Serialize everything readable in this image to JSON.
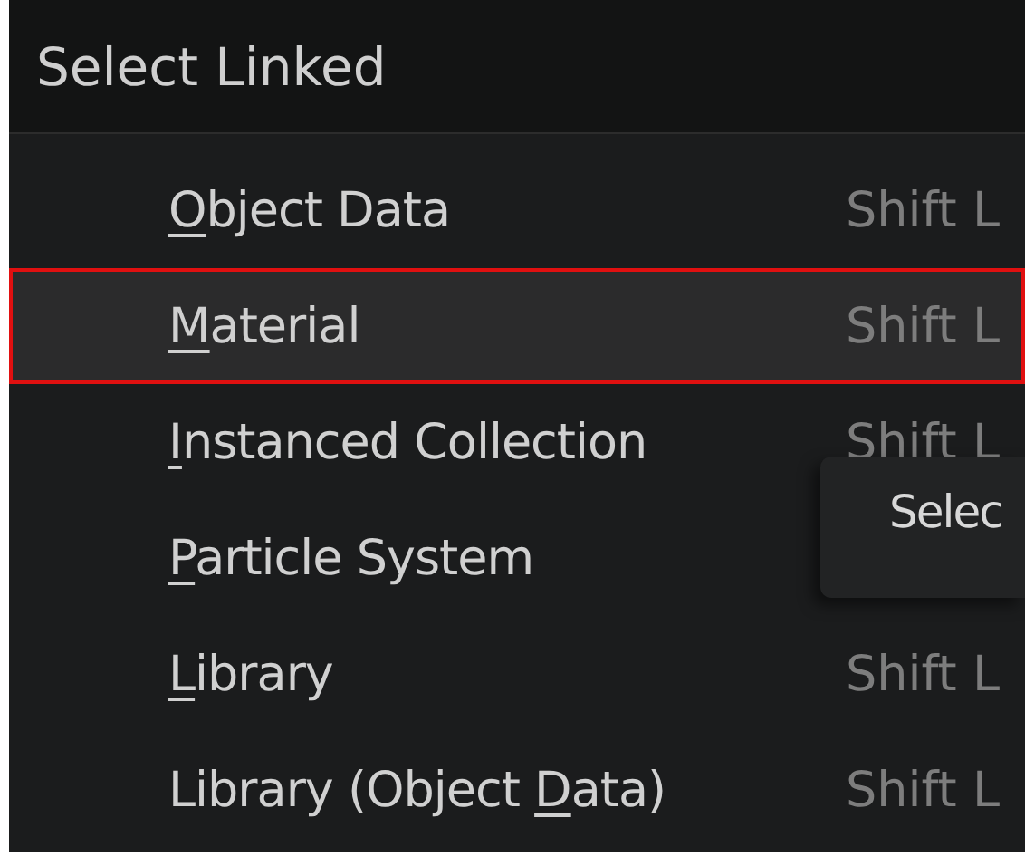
{
  "menu": {
    "title": "Select Linked",
    "items": [
      {
        "label": [
          {
            "text": "O",
            "underlined": true
          },
          {
            "text": "bject Data",
            "underlined": false
          }
        ],
        "shortcut": "Shift L",
        "selected": false
      },
      {
        "label": [
          {
            "text": "M",
            "underlined": true
          },
          {
            "text": "aterial",
            "underlined": false
          }
        ],
        "shortcut": "Shift L",
        "selected": true
      },
      {
        "label": [
          {
            "text": "I",
            "underlined": true
          },
          {
            "text": "nstanced Collection",
            "underlined": false
          }
        ],
        "shortcut": "Shift L",
        "selected": false
      },
      {
        "label": [
          {
            "text": "P",
            "underlined": true
          },
          {
            "text": "article System",
            "underlined": false
          }
        ],
        "selected": false
      },
      {
        "label": [
          {
            "text": "L",
            "underlined": true
          },
          {
            "text": "ibrary",
            "underlined": false
          }
        ],
        "shortcut": "Shift L",
        "selected": false
      },
      {
        "label": [
          {
            "text": "Library (Object ",
            "underlined": false
          },
          {
            "text": "D",
            "underlined": true
          },
          {
            "text": "ata)",
            "underlined": false
          }
        ],
        "shortcut": "Shift L",
        "selected": false
      }
    ]
  },
  "tooltip": {
    "text": "Selec"
  }
}
